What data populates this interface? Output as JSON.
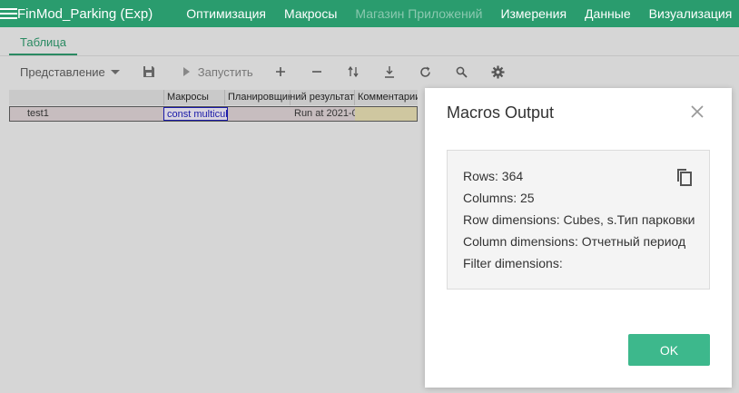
{
  "header": {
    "app_title": "FinMod_Parking (Exp)",
    "menu": [
      {
        "label": "Оптимизация",
        "disabled": false
      },
      {
        "label": "Макросы",
        "disabled": false
      },
      {
        "label": "Магазин Приложений",
        "disabled": true
      },
      {
        "label": "Измерения",
        "disabled": false
      },
      {
        "label": "Данные",
        "disabled": false
      },
      {
        "label": "Визуализация",
        "disabled": false
      }
    ]
  },
  "tabs": [
    {
      "label": "Таблица",
      "active": true
    }
  ],
  "toolbar": {
    "view_label": "Представление",
    "run_label": "Запустить",
    "icons": [
      "save-icon",
      "play-icon",
      "plus-icon",
      "minus-icon",
      "sort-icon",
      "download-icon",
      "refresh-icon",
      "search-icon",
      "gear-icon"
    ]
  },
  "grid": {
    "columns": [
      "Макросы",
      "Планировщик",
      "Последний результат",
      "Комментарии"
    ],
    "rows": [
      {
        "name": "test1",
        "macro": "const multicube",
        "scheduler": "",
        "last_result": "Run at 2021-0",
        "comment": ""
      }
    ]
  },
  "modal": {
    "title": "Macros Output",
    "lines": [
      "Rows: 364",
      "Columns: 25",
      "Row dimensions: Cubes, s.Тип парковки",
      "Column dimensions: Отчетный период",
      "Filter dimensions:"
    ],
    "ok_label": "OK"
  },
  "colors": {
    "brand": "#2a9c6e",
    "ok_button": "#3db88c",
    "overlay": "#d6d6d6",
    "macro_link": "#1a1aa8",
    "comment_cell": "#cfc7a0"
  }
}
